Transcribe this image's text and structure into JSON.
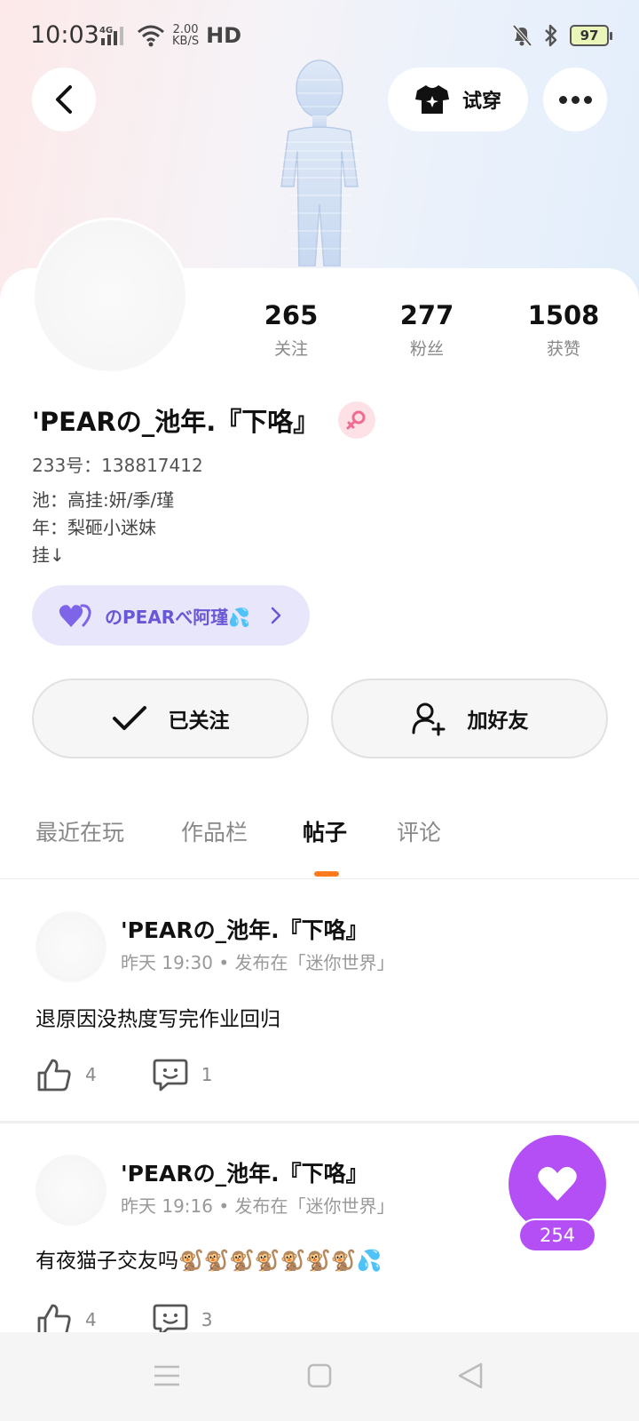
{
  "status_bar": {
    "time": "10:03",
    "network": "4G",
    "speed_value": "2.00",
    "speed_unit": "KB/S",
    "hd": "HD",
    "battery": "97"
  },
  "header": {
    "tryon_label": "试穿"
  },
  "stats": [
    {
      "value": "265",
      "label": "关注"
    },
    {
      "value": "277",
      "label": "粉丝"
    },
    {
      "value": "1508",
      "label": "获赞"
    }
  ],
  "profile": {
    "username": "'PEARの_池年.『下咯』",
    "uid": "233号：138817412",
    "bio": [
      "池：高挂:妍/季/瑾",
      "年：梨砸小迷妹",
      "挂↓"
    ],
    "fan_group": "のPEARべ阿瑾💦"
  },
  "actions": {
    "followed_label": "已关注",
    "add_friend_label": "加好友"
  },
  "tabs": [
    {
      "label": "最近在玩"
    },
    {
      "label": "作品栏"
    },
    {
      "label": "帖子"
    },
    {
      "label": "评论"
    }
  ],
  "posts": [
    {
      "author": "'PEARの_池年.『下咯』",
      "meta": "昨天 19:30 • 发布在「迷你世界」",
      "text": "退原因没热度写完作业回归",
      "likes": "4",
      "comments": "1"
    },
    {
      "author": "'PEARの_池年.『下咯』",
      "meta": "昨天 19:16 • 发布在「迷你世界」",
      "text": "有夜猫子交友吗🐒🐒🐒🐒🐒🐒🐒💦",
      "likes": "4",
      "comments": "3"
    }
  ],
  "floating_like": {
    "count": "254",
    "color": "#b44ef5"
  },
  "colors": {
    "accent_orange": "#ff7a1a",
    "fan_group_text": "#6857d6",
    "gender_pink": "#f06b8f"
  },
  "icons": [
    "back-arrow-icon",
    "shirt-icon",
    "more-dots-icon",
    "female-icon",
    "heart-icon",
    "chevron-right-icon",
    "check-icon",
    "add-user-icon",
    "thumbs-up-icon",
    "comment-icon",
    "menu-icon",
    "home-square-icon",
    "back-triangle-icon"
  ]
}
